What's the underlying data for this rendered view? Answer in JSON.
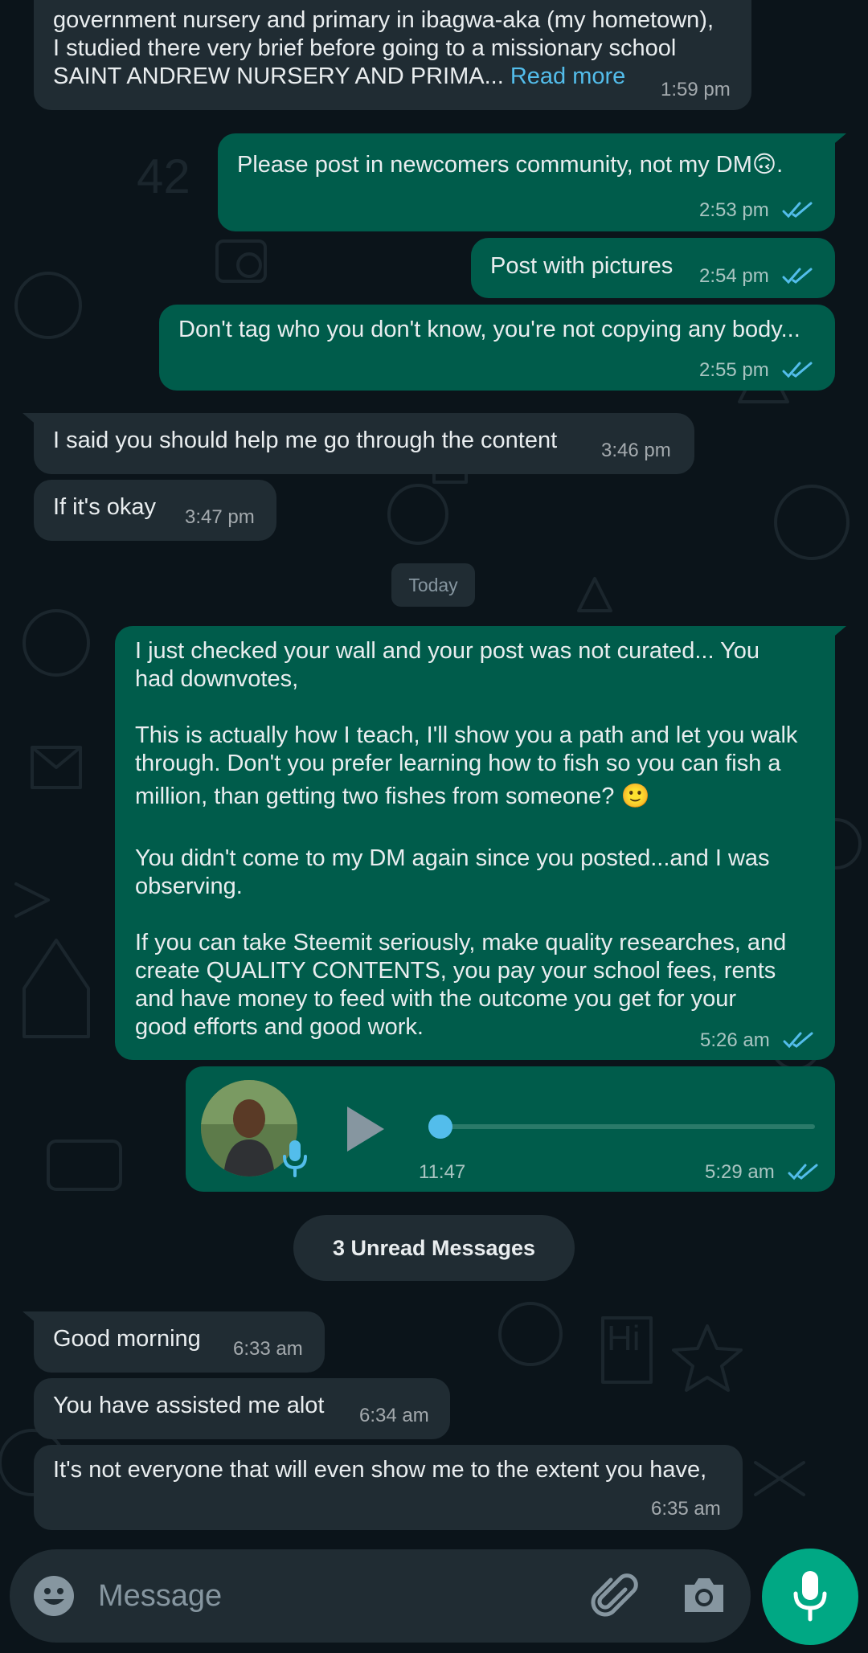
{
  "colors": {
    "background": "#0b141a",
    "incoming_bubble": "#202c33",
    "outgoing_bubble": "#005c4b",
    "read_ticks": "#53bdeb",
    "accent_green": "#00a884"
  },
  "messages": [
    {
      "direction": "incoming",
      "lines": [
        "government nursery and primary in ibagwa-aka (my hometown),",
        "I studied there very brief before going to a missionary  school",
        "SAINT ANDREW NURSERY AND PRIMA... "
      ],
      "read_more": "Read more",
      "time": "1:59 pm"
    },
    {
      "direction": "outgoing",
      "lines": [
        "Please post in newcomers community, not my DM🙃."
      ],
      "time": "2:53 pm",
      "status": "read"
    },
    {
      "direction": "outgoing",
      "lines": [
        "Post with pictures"
      ],
      "time": "2:54 pm",
      "status": "read"
    },
    {
      "direction": "outgoing",
      "lines": [
        "Don't tag who you don't know, you're not copying any body..."
      ],
      "time": "2:55 pm",
      "status": "read"
    },
    {
      "direction": "incoming",
      "lines": [
        "I said you should help me go through the content"
      ],
      "time": "3:46 pm"
    },
    {
      "direction": "incoming",
      "lines": [
        "If it's okay"
      ],
      "time": "3:47 pm"
    },
    {
      "direction": "outgoing",
      "lines": [
        "I just checked your wall and your post was not curated... You",
        "had downvotes,",
        "",
        "This is actually how I teach, I'll show you a path and let you walk",
        "through. Don't you prefer learning how to fish so you can fish a",
        "million, than getting two fishes from someone? 🙂",
        "",
        "You didn't come to my DM again since you posted...and I was",
        "observing.",
        "",
        "If you can take Steemit seriously, make quality researches, and",
        "create QUALITY CONTENTS, you pay your school fees, rents",
        "and have money to feed with the outcome you get for your",
        "good efforts and good work."
      ],
      "time": "5:26 am",
      "status": "read"
    },
    {
      "direction": "incoming",
      "lines": [
        "Good morning"
      ],
      "time": "6:33 am"
    },
    {
      "direction": "incoming",
      "lines": [
        "You have assisted me alot"
      ],
      "time": "6:34 am"
    },
    {
      "direction": "incoming",
      "lines": [
        "It's not everyone that will even show me to the extent you have,"
      ],
      "time": "6:35 am"
    }
  ],
  "voice_note": {
    "duration": "11:47",
    "time": "5:29 am",
    "status": "read",
    "progress": 0.0
  },
  "date_divider": "Today",
  "unread_banner": "3 Unread Messages",
  "composer": {
    "placeholder": "Message",
    "icons": [
      "emoji-icon",
      "attach-icon",
      "camera-icon",
      "mic-icon"
    ]
  }
}
